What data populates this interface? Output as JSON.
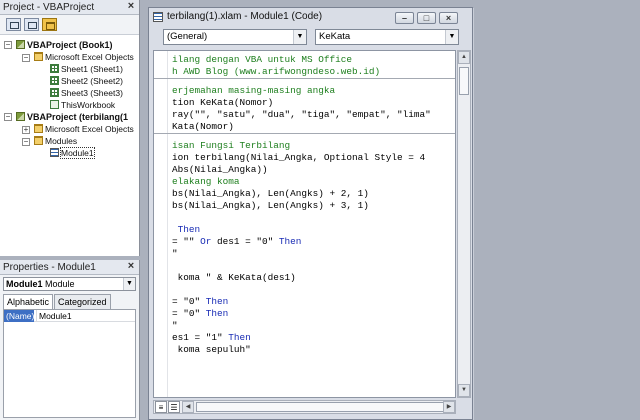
{
  "project_pane": {
    "title": "Project - VBAProject",
    "close_glyph": "×",
    "toolbar": [
      "view-code-icon",
      "view-object-icon",
      "toggle-folders-icon"
    ],
    "tree": {
      "project1": "VBAProject (Book1)",
      "folder_excel_objects_1": "Microsoft Excel Objects",
      "sheet1": "Sheet1 (Sheet1)",
      "sheet2": "Sheet2 (Sheet2)",
      "sheet3": "Sheet3 (Sheet3)",
      "thisworkbook": "ThisWorkbook",
      "project2": "VBAProject (terbilang(1",
      "folder_excel_objects_2": "Microsoft Excel Objects",
      "folder_modules": "Modules",
      "module1": "Module1"
    }
  },
  "properties_pane": {
    "title": "Properties - Module1",
    "close_glyph": "×",
    "object_name": "Module1",
    "object_type": "Module",
    "tabs": [
      "Alphabetic",
      "Categorized"
    ],
    "rows": [
      {
        "name": "(Name)",
        "value": "Module1"
      }
    ]
  },
  "code_window": {
    "title": "terbilang(1).xlam - Module1 (Code)",
    "object_combo": "(General)",
    "procedure_combo": "KeKata",
    "window_buttons": {
      "minimize": "–",
      "restore": "□",
      "close": "×"
    },
    "code_blocks": [
      {
        "lines": [
          {
            "t": "ilang dengan VBA untuk MS Office",
            "c": "cm"
          },
          {
            "t": "h AWD Blog (www.arifwongndeso.web.id)",
            "c": "cm"
          }
        ]
      },
      {
        "lines": [
          {
            "t": "erjemahan masing-masing angka",
            "c": "cm"
          },
          {
            "t": "tion KeKata(Nomor)",
            "c": ""
          },
          {
            "t": "ray(\"\", \"satu\", \"dua\", \"tiga\", \"empat\", \"lima\"",
            "c": ""
          },
          {
            "t": "Kata(Nomor)",
            "c": ""
          }
        ]
      },
      {
        "lines": [
          {
            "t": "isan Fungsi Terbilang",
            "c": "cm"
          },
          {
            "t": "ion terbilang(Nilai_Angka, Optional Style = 4",
            "c": ""
          },
          {
            "t": "Abs(Nilai_Angka))",
            "c": ""
          },
          {
            "t": "elakang koma",
            "c": "cm"
          },
          {
            "t": "bs(Nilai_Angka), Len(Angks) + 2, 1)",
            "c": ""
          },
          {
            "t": "bs(Nilai_Angka), Len(Angks) + 3, 1)",
            "c": ""
          },
          {
            "t": "",
            "c": ""
          },
          {
            "t": " Then",
            "c": "kwline"
          },
          {
            "t": "= \"\" Or des1 = \"0\" Then",
            "c": "kwline"
          },
          {
            "t": "\"",
            "c": ""
          },
          {
            "t": "",
            "c": ""
          },
          {
            "t": " koma \" & KeKata(des1)",
            "c": ""
          },
          {
            "t": "",
            "c": ""
          },
          {
            "t": "= \"0\" Then",
            "c": "kwline"
          },
          {
            "t": "= \"0\" Then",
            "c": "kwline"
          },
          {
            "t": "\"",
            "c": ""
          },
          {
            "t": "es1 = \"1\" Then",
            "c": "kwline"
          },
          {
            "t": " koma sepuluh\"",
            "c": ""
          }
        ]
      }
    ]
  }
}
